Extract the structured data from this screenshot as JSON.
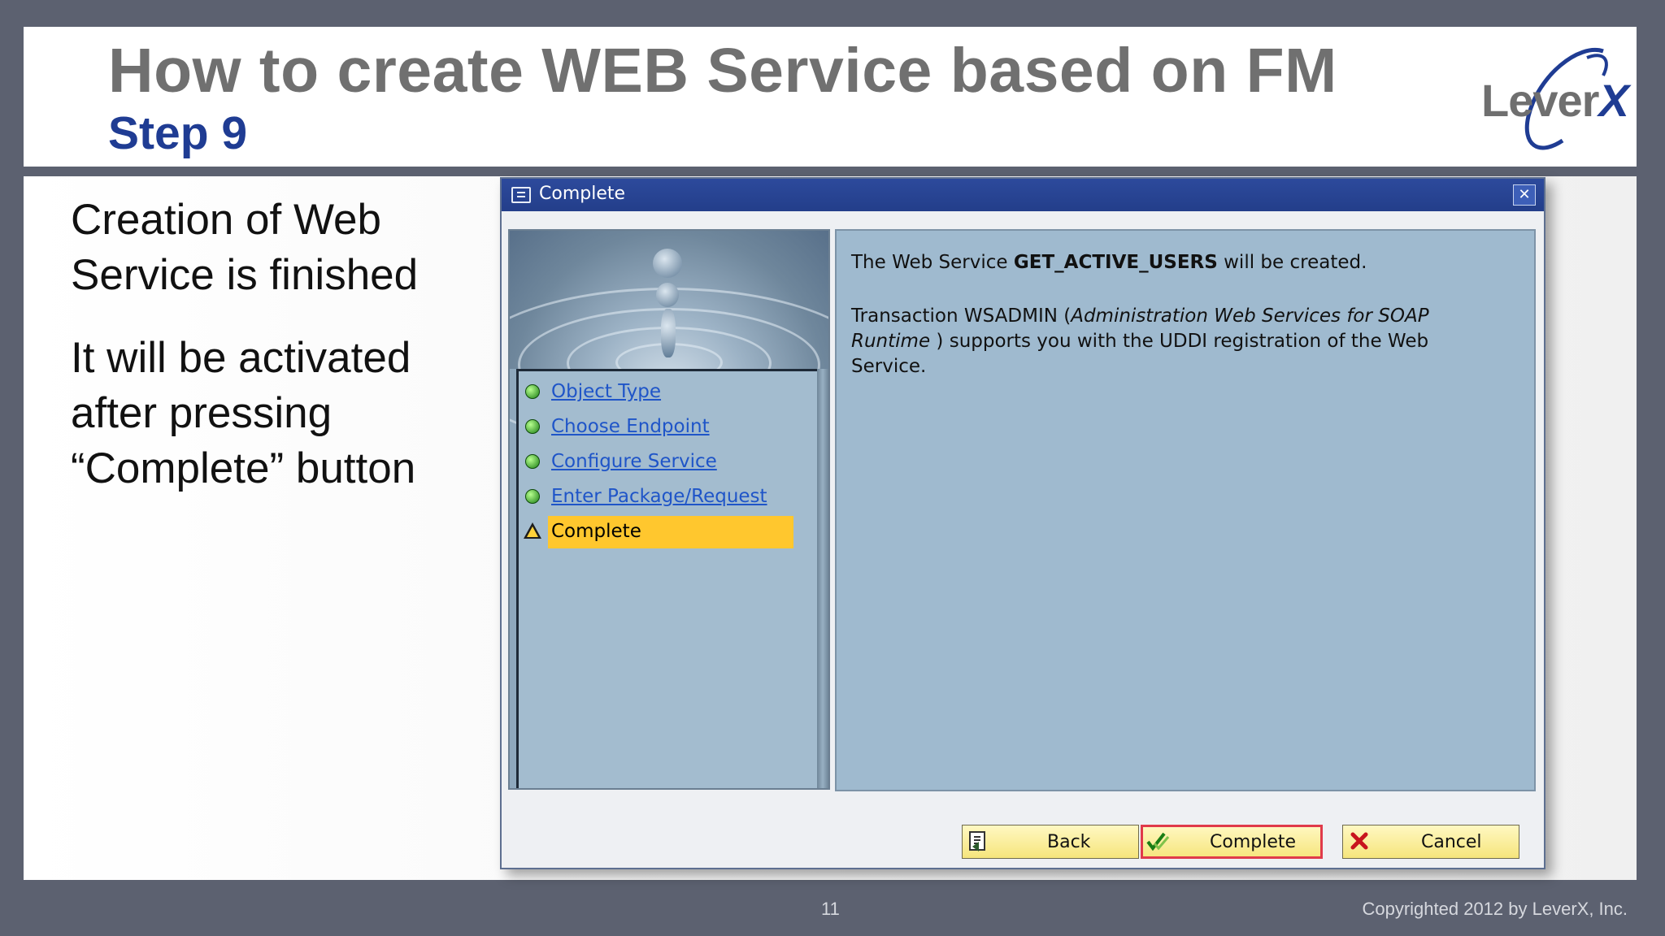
{
  "slide": {
    "title": "How to create WEB Service based on FM",
    "subtitle": "Step 9",
    "logo": "LeverX",
    "bullets": [
      "Creation of Web Service is finished",
      "It will be activated after pressing “Complete” button"
    ],
    "page_number": "11",
    "copyright": "Copyrighted 2012 by LeverX, Inc."
  },
  "dialog": {
    "title": "Complete",
    "close_label": "✕",
    "steps": [
      {
        "label": "Object Type",
        "status": "done"
      },
      {
        "label": "Choose Endpoint",
        "status": "done"
      },
      {
        "label": "Configure Service",
        "status": "done"
      },
      {
        "label": "Enter Package/Request",
        "status": "done"
      },
      {
        "label": "Complete",
        "status": "current"
      }
    ],
    "message": {
      "line1_prefix": "The Web Service ",
      "service_name": "GET_ACTIVE_USERS",
      "line1_suffix": " will be created.",
      "line2_prefix": "Transaction WSADMIN (",
      "line2_italic": "Administration Web Services for SOAP Runtime",
      "line2_suffix": " ) supports you with the UDDI registration of the Web Service."
    },
    "buttons": {
      "back": "Back",
      "complete": "Complete",
      "cancel": "Cancel"
    }
  },
  "colors": {
    "title_gray": "#707070",
    "subtitle_blue": "#1f3c93",
    "sap_titlebar": "#233e8a",
    "active_step": "#ffc72e",
    "panel_blue": "#9fbacf"
  }
}
